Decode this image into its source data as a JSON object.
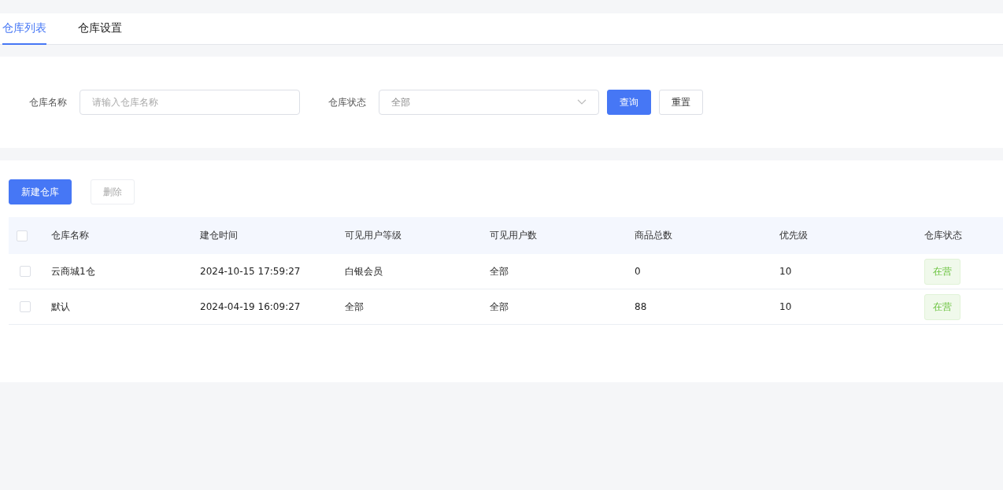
{
  "tabs": [
    {
      "label": "仓库列表",
      "selected": true
    },
    {
      "label": "仓库设置",
      "selected": false
    }
  ],
  "filters": {
    "name_label": "仓库名称",
    "name_placeholder": "请输入仓库名称",
    "status_label": "仓库状态",
    "status_value": "全部",
    "buttons": [
      {
        "label": "查询",
        "kind": "primary"
      },
      {
        "label": "重置",
        "kind": "default"
      }
    ]
  },
  "toolbar": [
    {
      "label": "新建仓库",
      "kind": "primary",
      "disabled": false
    },
    {
      "label": "删除",
      "kind": "default",
      "disabled": true
    }
  ],
  "table": {
    "all_checked": false,
    "columns": [
      "仓库名称",
      "建仓时间",
      "可见用户等级",
      "可见用户数",
      "商品总数",
      "优先级",
      "仓库状态"
    ],
    "rows": [
      {
        "checked": false,
        "cells": [
          "云商城1仓",
          "2024-10-15 17:59:27",
          "白银会员",
          "全部",
          "0",
          "10"
        ],
        "status": {
          "label": "在营",
          "kind": "active"
        }
      },
      {
        "checked": false,
        "cells": [
          "默认",
          "2024-04-19 16:09:27",
          "全部",
          "全部",
          "88",
          "10"
        ],
        "status": {
          "label": "在营",
          "kind": "active"
        }
      }
    ]
  }
}
